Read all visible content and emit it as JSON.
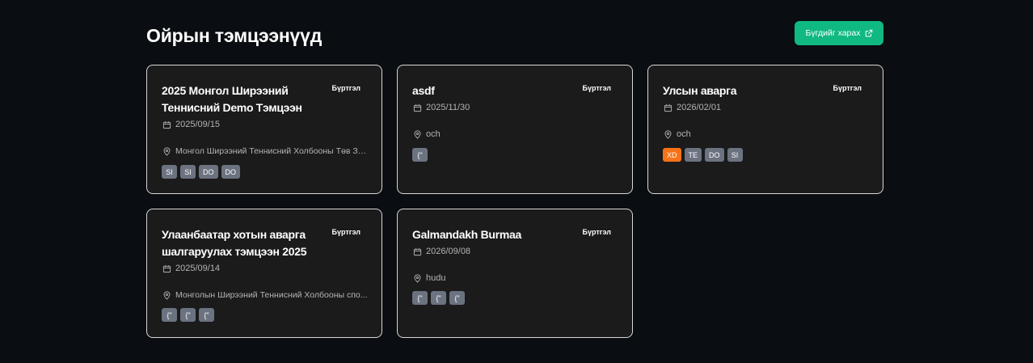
{
  "header": {
    "title": "Ойрын тэмцээнүүд",
    "view_all_label": "Бүгдийг харах"
  },
  "tournaments": [
    {
      "title": "2025 Монгол Ширээний Теннисний Demo Тэмцээн",
      "status": "Бүртгэл",
      "date": "2025/09/15",
      "location": "Монгол Ширээний Теннисний Холбооны Төв За...",
      "tags": [
        {
          "label": "SI"
        },
        {
          "label": "SI"
        },
        {
          "label": "DO"
        },
        {
          "label": "DO"
        }
      ]
    },
    {
      "title": "asdf",
      "status": "Бүртгэл",
      "date": "2025/11/30",
      "location": "och",
      "tags": [
        {
          "label": "{\""
        }
      ]
    },
    {
      "title": "Улсын аварга",
      "status": "Бүртгэл",
      "date": "2026/02/01",
      "location": "och",
      "tags": [
        {
          "label": "XD",
          "color": "#f97316"
        },
        {
          "label": "TE"
        },
        {
          "label": "DO"
        },
        {
          "label": "SI"
        }
      ]
    },
    {
      "title": "Улаанбаатар хотын аварга шалгаруулах тэмцээн 2025",
      "status": "Бүртгэл",
      "date": "2025/09/14",
      "location": "Монголын Ширээний Теннисний Холбооны спо...",
      "tags": [
        {
          "label": "{\""
        },
        {
          "label": "{\""
        },
        {
          "label": "{\""
        }
      ]
    },
    {
      "title": "Galmandakh Burmaa",
      "status": "Бүртгэл",
      "date": "2026/09/08",
      "location": "hudu",
      "tags": [
        {
          "label": "{\""
        },
        {
          "label": "{\""
        },
        {
          "label": "{\""
        }
      ]
    }
  ],
  "icons": {
    "date": "calendar-icon",
    "location": "map-pin-icon",
    "external": "external-link-icon"
  },
  "colors": {
    "accent": "#10b981",
    "tag_default": "#6b7280",
    "tag_highlight": "#f97316"
  }
}
